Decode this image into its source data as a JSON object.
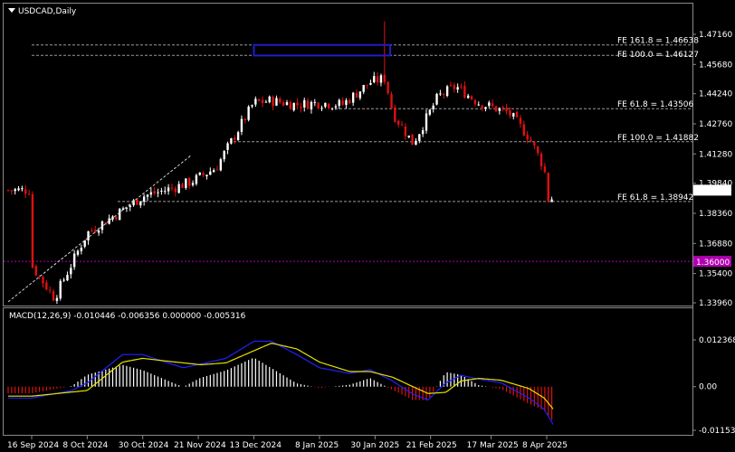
{
  "window": {
    "symbol_title": "USDCAD,Daily",
    "menu_icon": "triangle-down-icon"
  },
  "colors": {
    "background": "#000000",
    "grid": "#5a5a5a",
    "bull_candle": "#ffffff",
    "bear_candle": "#e01010",
    "macd_line": "#2020ff",
    "signal_line": "#e8e000",
    "hist_pos": "#ffffff",
    "hist_neg": "#e01010",
    "support_line": "#b000b0",
    "price_label_bg": "#1e1ec8",
    "box": "#1e1ec8"
  },
  "chart_data": [
    {
      "type": "candlestick",
      "title": "USDCAD,Daily",
      "y_ticks": [
        "1.47160",
        "1.45680",
        "1.44240",
        "1.42760",
        "1.41280",
        "1.39840",
        "1.38360",
        "1.36880",
        "1.35400",
        "1.33960"
      ],
      "ylim": [
        1.3392,
        1.478
      ],
      "x_ticks": [
        "16 Sep 2024",
        "8 Oct 2024",
        "30 Oct 2024",
        "21 Nov 2024",
        "13 Dec 2024",
        "8 Jan 2025",
        "30 Jan 2025",
        "21 Feb 2025",
        "17 Mar 2025",
        "8 Apr 2025"
      ],
      "current_price": "1.39499",
      "support_level": {
        "label": "1.36000",
        "value": 1.36
      },
      "fibonacci_levels": [
        {
          "label": "FE 161.8 = 1.46638",
          "value": 1.46638
        },
        {
          "label": "FE 100.0 = 1.46127",
          "value": 1.46127
        },
        {
          "label": "FE 61.8 = 1.43506",
          "value": 1.43506
        },
        {
          "label": "FE 100.0 = 1.41882",
          "value": 1.41882
        },
        {
          "label": "FE 61.8 = 1.38942",
          "value": 1.38942
        }
      ],
      "highlight_box": {
        "from": "13 Dec 2024",
        "to": "5 Feb 2025",
        "high": 1.4664,
        "low": 1.4612
      },
      "trendline": {
        "from": [
          "16 Sep 2024",
          1.341
        ],
        "to": [
          "18 Nov 2024",
          1.412
        ]
      },
      "path_points": [
        {
          "date": "16 Sep 2024",
          "close": 1.358
        },
        {
          "date": "25 Sep 2024",
          "close": 1.342
        },
        {
          "date": "8 Oct 2024",
          "close": 1.374
        },
        {
          "date": "23 Oct 2024",
          "close": 1.386
        },
        {
          "date": "30 Oct 2024",
          "close": 1.392
        },
        {
          "date": "8 Nov 2024",
          "close": 1.395
        },
        {
          "date": "18 Nov 2024",
          "close": 1.399
        },
        {
          "date": "28 Nov 2024",
          "close": 1.406
        },
        {
          "date": "13 Dec 2024",
          "close": 1.438
        },
        {
          "date": "20 Dec 2024",
          "close": 1.439
        },
        {
          "date": "30 Dec 2024",
          "close": 1.437
        },
        {
          "date": "8 Jan 2025",
          "close": 1.438
        },
        {
          "date": "17 Jan 2025",
          "close": 1.437
        },
        {
          "date": "28 Jan 2025",
          "close": 1.448
        },
        {
          "date": "3 Feb 2025",
          "close": 1.45
        },
        {
          "date": "6 Feb 2025",
          "close": 1.433
        },
        {
          "date": "14 Feb 2025",
          "close": 1.418
        },
        {
          "date": "24 Feb 2025",
          "close": 1.441
        },
        {
          "date": "3 Mar 2025",
          "close": 1.446
        },
        {
          "date": "12 Mar 2025",
          "close": 1.438
        },
        {
          "date": "24 Mar 2025",
          "close": 1.433
        },
        {
          "date": "1 Apr 2025",
          "close": 1.421
        },
        {
          "date": "7 Apr 2025",
          "close": 1.406
        },
        {
          "date": "9 Apr 2025",
          "close": 1.387
        },
        {
          "date": "11 Apr 2025",
          "close": 1.395
        }
      ],
      "spike": {
        "date": "3 Feb 2025",
        "high": 1.478,
        "low": 1.448
      }
    },
    {
      "type": "line",
      "title": "MACD(12,26,9) -0.010446 -0.006356 0.000000 -0.005316",
      "y_ticks": [
        "0.012368",
        "0.00",
        "-0.011532"
      ],
      "ylim": [
        -0.011532,
        0.012368
      ],
      "series": [
        {
          "name": "MACD",
          "points": [
            [
              "16 Sep 2024",
              -0.003
            ],
            [
              "2 Oct 2024",
              -0.001
            ],
            [
              "8 Oct 2024",
              0.001
            ],
            [
              "22 Oct 2024",
              0.0085
            ],
            [
              "30 Oct 2024",
              0.0085
            ],
            [
              "8 Nov 2024",
              0.0065
            ],
            [
              "15 Nov 2024",
              0.005
            ],
            [
              "22 Nov 2024",
              0.006
            ],
            [
              "2 Dec 2024",
              0.0075
            ],
            [
              "13 Dec 2024",
              0.012
            ],
            [
              "20 Dec 2024",
              0.012
            ],
            [
              "30 Dec 2024",
              0.0085
            ],
            [
              "8 Jan 2025",
              0.005
            ],
            [
              "20 Jan 2025",
              0.0035
            ],
            [
              "28 Jan 2025",
              0.0045
            ],
            [
              "6 Feb 2025",
              0.0015
            ],
            [
              "14 Feb 2025",
              -0.002
            ],
            [
              "20 Feb 2025",
              -0.0035
            ],
            [
              "27 Feb 2025",
              0.001
            ],
            [
              "5 Mar 2025",
              0.003
            ],
            [
              "12 Mar 2025",
              0.002
            ],
            [
              "21 Mar 2025",
              0.001
            ],
            [
              "1 Apr 2025",
              -0.003
            ],
            [
              "7 Apr 2025",
              -0.006
            ],
            [
              "11 Apr 2025",
              -0.0105
            ]
          ]
        },
        {
          "name": "Signal",
          "points": [
            [
              "16 Sep 2024",
              -0.0025
            ],
            [
              "8 Oct 2024",
              -0.001
            ],
            [
              "22 Oct 2024",
              0.0065
            ],
            [
              "30 Oct 2024",
              0.0075
            ],
            [
              "8 Nov 2024",
              0.0068
            ],
            [
              "22 Nov 2024",
              0.0058
            ],
            [
              "2 Dec 2024",
              0.0063
            ],
            [
              "13 Dec 2024",
              0.0095
            ],
            [
              "20 Dec 2024",
              0.0115
            ],
            [
              "30 Dec 2024",
              0.01
            ],
            [
              "8 Jan 2025",
              0.0065
            ],
            [
              "20 Jan 2025",
              0.004
            ],
            [
              "28 Jan 2025",
              0.004
            ],
            [
              "6 Feb 2025",
              0.0025
            ],
            [
              "14 Feb 2025",
              0.0
            ],
            [
              "20 Feb 2025",
              -0.0018
            ],
            [
              "27 Feb 2025",
              -0.0015
            ],
            [
              "5 Mar 2025",
              0.0015
            ],
            [
              "12 Mar 2025",
              0.0022
            ],
            [
              "21 Mar 2025",
              0.0017
            ],
            [
              "1 Apr 2025",
              -0.0005
            ],
            [
              "7 Apr 2025",
              -0.003
            ],
            [
              "11 Apr 2025",
              -0.0063
            ]
          ]
        }
      ]
    }
  ]
}
